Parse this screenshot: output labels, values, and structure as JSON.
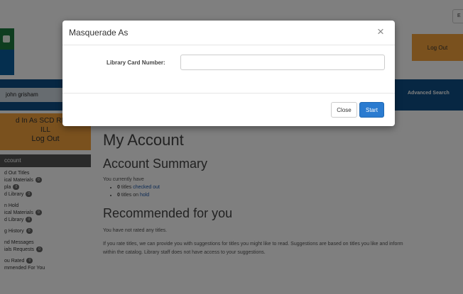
{
  "page": {
    "corner_button": "E",
    "logout_top": "Log Out",
    "nav": {
      "user": "john grisham",
      "advanced_search": "Advanced Search"
    },
    "masquerade_box": {
      "line1": "d In As SCD REFE",
      "line2": "ILL",
      "line3": "Log Out"
    },
    "sidebar": {
      "header": "ccount",
      "items": [
        {
          "label": "d Out Titles",
          "badge": ""
        },
        {
          "label": "ical Materials",
          "badge": "0"
        },
        {
          "label": "pla",
          "badge": "0"
        },
        {
          "label": "d Library",
          "badge": "0"
        },
        {
          "label": "n Hold",
          "badge": ""
        },
        {
          "label": "ical Materials",
          "badge": "0"
        },
        {
          "label": "d Library",
          "badge": "0"
        },
        {
          "label": "g History",
          "badge": "0"
        },
        {
          "label": "nd Messages",
          "badge": ""
        },
        {
          "label": "ials Requests",
          "badge": "0"
        },
        {
          "label": "ou Rated",
          "badge": "0"
        },
        {
          "label": "mmended For You",
          "badge": ""
        }
      ]
    },
    "main": {
      "title": "My Account",
      "summary_title": "Account Summary",
      "you_have": "You currently have",
      "checked_out": {
        "count": "0",
        "text": "titles",
        "link": "checked out"
      },
      "on_hold": {
        "count": "0",
        "text": "titles on",
        "link": "hold"
      },
      "recommended_title": "Recommended for you",
      "not_rated": "You have not rated any titles.",
      "rec_text_1": "If you rate titles, we can provide you with suggestions for titles you might like to read. Suggestions are based on titles you like and inform",
      "rec_text_2": "within the catalog. Library staff does not have access to your suggestions."
    }
  },
  "modal": {
    "title": "Masquerade As",
    "close_glyph": "×",
    "field_label": "Library Card Number:",
    "field_value": "",
    "field_placeholder": "",
    "close_label": "Close",
    "start_label": "Start"
  },
  "colors": {
    "accent_orange": "#f4a23c",
    "nav_blue": "#0f4f86",
    "primary_button": "#2a7bd0"
  }
}
